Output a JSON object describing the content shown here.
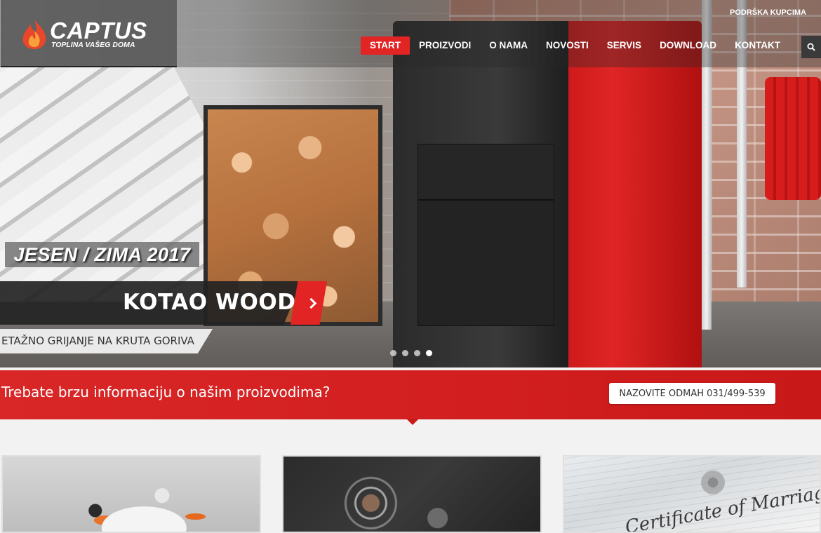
{
  "header": {
    "logo_text": "CAPTUS",
    "logo_tagline": "TOPLINA VAŠEG DOMA",
    "support_link": "PODRŠKA KUPCIMA",
    "search_icon": "search-icon"
  },
  "nav": {
    "items": [
      {
        "label": "START",
        "active": true
      },
      {
        "label": "PROIZVODI",
        "active": false
      },
      {
        "label": "O NAMA",
        "active": false
      },
      {
        "label": "NOVOSTI",
        "active": false
      },
      {
        "label": "SERVIS",
        "active": false
      },
      {
        "label": "DOWNLOAD",
        "active": false
      },
      {
        "label": "KONTAKT",
        "active": false
      }
    ]
  },
  "hero": {
    "season": "JESEN / ZIMA 2017",
    "product_title": "KOTAO WOOD",
    "tagline": "ETAŽNO GRIJANJE NA KRUTA GORIVA",
    "arrow_icon": "chevron-right-icon",
    "slides_total": 4,
    "active_slide": 4
  },
  "info": {
    "question": "Trebate brzu informaciju o našim proizvodima?",
    "call_button": "NAZOVITE ODMAH 031/499-539"
  },
  "cards": [
    {
      "image": "meeting-photo"
    },
    {
      "image": "technology-photo"
    },
    {
      "image": "certificate-photo",
      "caption_art": "Certificate of Marriage"
    }
  ],
  "colors": {
    "accent": "#e22424",
    "info_bar": "#d21e1e",
    "dark_bar": "#232323"
  }
}
